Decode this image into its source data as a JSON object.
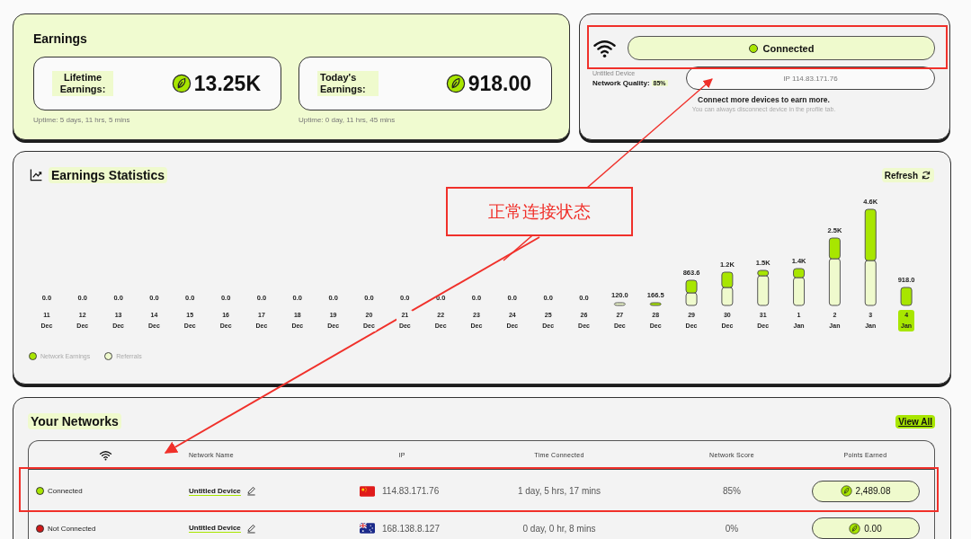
{
  "earnings": {
    "title": "Earnings",
    "cards": [
      {
        "label": "Lifetime Earnings:",
        "value": "13.25K",
        "uptime": "Uptime: 5 days, 11 hrs, 5 mins"
      },
      {
        "label": "Today's Earnings:",
        "value": "918.00",
        "uptime": "Uptime: 0 day, 11 hrs, 45 mins"
      }
    ]
  },
  "device": {
    "status": "Connected",
    "connected": true,
    "name": "Untitled Device",
    "quality_label": "Network Quality:",
    "quality": "85%",
    "ip": "IP 114.83.171.76",
    "prompt": "Connect more devices to earn more.",
    "hint": "You can always disconnect device in the profile tab."
  },
  "statistics": {
    "title": "Earnings Statistics",
    "refresh": "Refresh",
    "days": [
      {
        "date": "11 Dec",
        "total": "0.0",
        "selected": false
      },
      {
        "date": "12 Dec",
        "total": "0.0",
        "selected": false
      },
      {
        "date": "13 Dec",
        "total": "0.0",
        "selected": false
      },
      {
        "date": "14 Dec",
        "total": "0.0",
        "selected": false
      },
      {
        "date": "15 Dec",
        "total": "0.0",
        "selected": false
      },
      {
        "date": "16 Dec",
        "total": "0.0",
        "selected": false
      },
      {
        "date": "17 Dec",
        "total": "0.0",
        "selected": false
      },
      {
        "date": "18 Dec",
        "total": "0.0",
        "selected": false
      },
      {
        "date": "19 Dec",
        "total": "0.0",
        "selected": false
      },
      {
        "date": "20 Dec",
        "total": "0.0",
        "selected": false
      },
      {
        "date": "21 Dec",
        "total": "0.0",
        "selected": false
      },
      {
        "date": "22 Dec",
        "total": "0.0",
        "selected": false
      },
      {
        "date": "23 Dec",
        "total": "0.0",
        "selected": false
      },
      {
        "date": "24 Dec",
        "total": "0.0",
        "selected": false
      },
      {
        "date": "25 Dec",
        "total": "0.0",
        "selected": false
      },
      {
        "date": "26 Dec",
        "total": "0.0",
        "selected": false
      },
      {
        "date": "27 Dec",
        "total": "120.0",
        "selected": false
      },
      {
        "date": "28 Dec",
        "total": "166.5",
        "selected": false
      },
      {
        "date": "29 Dec",
        "total": "863.6",
        "selected": false
      },
      {
        "date": "30 Dec",
        "total": "1.2K",
        "selected": false
      },
      {
        "date": "31 Dec",
        "total": "1.5K",
        "selected": false
      },
      {
        "date": "1 Jan",
        "total": "1.4K",
        "selected": false
      },
      {
        "date": "2 Jan",
        "total": "2.5K",
        "selected": false
      },
      {
        "date": "3 Jan",
        "total": "4.6K",
        "selected": false
      },
      {
        "date": "4 Jan",
        "total": "918.0",
        "selected": true
      }
    ],
    "legend": [
      {
        "label": "Network Earnings",
        "color": "#a8e600"
      },
      {
        "label": "Referrals",
        "color": "#effacd"
      }
    ]
  },
  "networks": {
    "title": "Your Networks",
    "view_all": "View All",
    "columns": [
      "Network Name",
      "IP",
      "Time Connected",
      "Network Score",
      "Points Earned"
    ],
    "rows": [
      {
        "status": "Connected",
        "connected": true,
        "name": "Untitled Device",
        "kind": "china",
        "ip": "114.83.171.76",
        "time": "1 day, 5 hrs, 17 mins",
        "score": "85%",
        "points": "2,489.08"
      },
      {
        "status": "Not Connected",
        "connected": false,
        "name": "Untitled Device",
        "kind": "australia",
        "ip": "168.138.8.127",
        "time": "0 day, 0 hr, 8 mins",
        "score": "0%",
        "points": "0.00"
      }
    ]
  },
  "annotation": {
    "label": "正常连接状态"
  }
}
